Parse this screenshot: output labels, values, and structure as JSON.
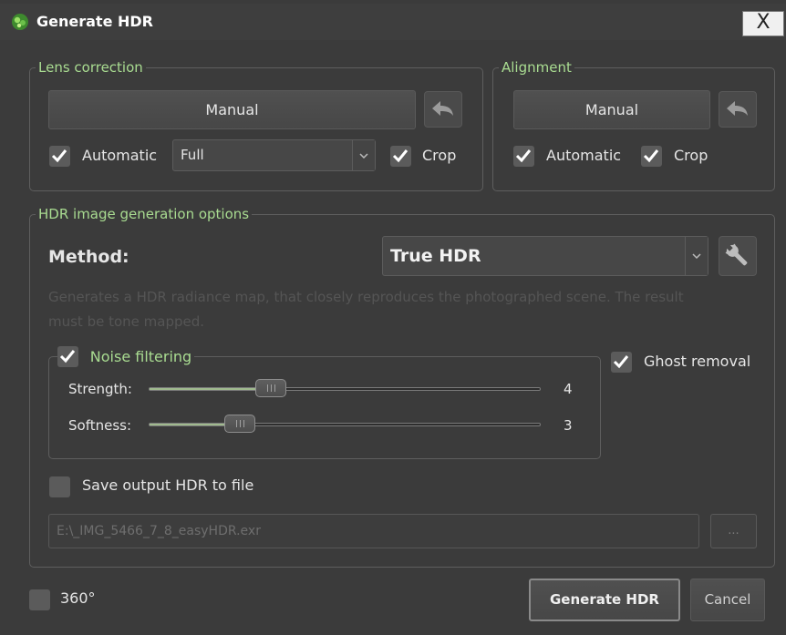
{
  "title": "Generate HDR",
  "close_label": "X",
  "lens_correction": {
    "legend": "Lens correction",
    "manual_label": "Manual",
    "automatic_label": "Automatic",
    "automatic_checked": true,
    "mode_value": "Full",
    "crop_label": "Crop",
    "crop_checked": true
  },
  "alignment": {
    "legend": "Alignment",
    "manual_label": "Manual",
    "automatic_label": "Automatic",
    "automatic_checked": true,
    "crop_label": "Crop",
    "crop_checked": true
  },
  "hdr_options": {
    "legend": "HDR image generation options",
    "method_label": "Method:",
    "method_value": "True HDR",
    "description_line1": "Generates a HDR radiance map, that closely reproduces the photographed scene. The result",
    "description_line2": "must be tone mapped.",
    "noise_filtering": {
      "label": "Noise filtering",
      "checked": true,
      "strength_label": "Strength:",
      "strength_value": "4",
      "strength_fraction": 0.31,
      "softness_label": "Softness:",
      "softness_value": "3",
      "softness_fraction": 0.23
    },
    "ghost_removal_label": "Ghost removal",
    "ghost_removal_checked": true,
    "save_output_label": "Save output HDR to file",
    "save_output_checked": false,
    "output_path": "E:\\_IMG_5466_7_8_easyHDR.exr",
    "browse_label": "..."
  },
  "footer": {
    "panorama_label": "360°",
    "panorama_checked": false,
    "generate_label": "Generate HDR",
    "cancel_label": "Cancel"
  },
  "colors": {
    "legend_green": "#a9dc91",
    "slider_fill": "#a0ba8e",
    "background": "#3b3b3b"
  }
}
